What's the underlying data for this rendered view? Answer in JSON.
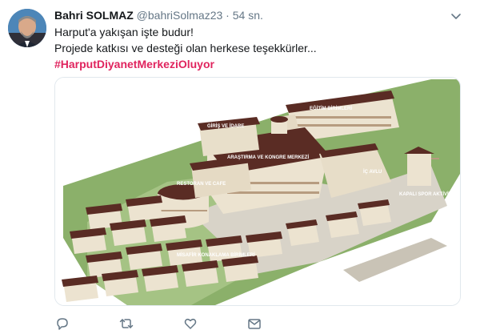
{
  "tweet": {
    "author_name": "Bahri SOLMAZ",
    "handle": "@bahriSolmaz23",
    "separator": "·",
    "time": "54 sn.",
    "line1": "Harput'a yakışan işte budur!",
    "line2": "Projede katkısı ve desteği olan herkese teşekkürler...",
    "hashtag": "#HarputDiyanetMerkeziOluyor"
  },
  "image_labels": {
    "egitim": "EĞİTİM BİRİMLERİ",
    "giris": "GİRİŞ VE İDARE",
    "arastirma": "ARAŞTIRMA VE KONGRE MERKEZİ",
    "avlu": "İÇ AVLU",
    "restoran": "RESTORAN VE CAFE",
    "spor": "KAPALI SPOR AKTİVİTE",
    "konaklama": "MİSAFİR KONAKLAMA BİRİMLERİ"
  },
  "icons": {
    "reply": "reply-icon",
    "retweet": "retweet-icon",
    "like": "like-icon",
    "dm": "dm-icon",
    "caret": "chevron-down-icon"
  },
  "colors": {
    "hashtag": "#e0245e",
    "muted": "#657786",
    "roof": "#5a2c24",
    "wall": "#ece3d0"
  }
}
